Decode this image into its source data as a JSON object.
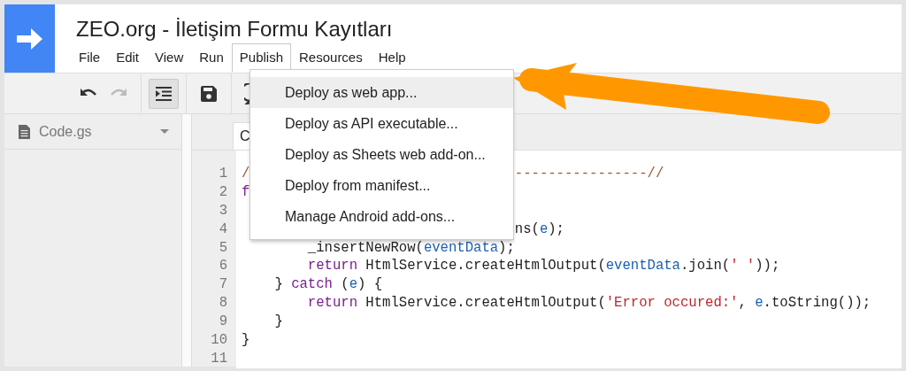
{
  "app": {
    "title": "ZEO.org - İletişim Formu Kayıtları"
  },
  "menu_bar": [
    {
      "label": "File",
      "selected": false
    },
    {
      "label": "Edit",
      "selected": false
    },
    {
      "label": "View",
      "selected": false
    },
    {
      "label": "Run",
      "selected": false
    },
    {
      "label": "Publish",
      "selected": true
    },
    {
      "label": "Resources",
      "selected": false
    },
    {
      "label": "Help",
      "selected": false
    }
  ],
  "toolbar": [
    {
      "kind": "undo",
      "disabled": false,
      "pressed": false
    },
    {
      "kind": "redo",
      "disabled": true,
      "pressed": false
    },
    {
      "kind": "indent",
      "disabled": false,
      "pressed": true
    },
    {
      "kind": "save",
      "disabled": false,
      "pressed": false
    },
    {
      "kind": "trigger",
      "disabled": false,
      "pressed": false
    }
  ],
  "sidebar": {
    "files": [
      {
        "name": "Code.gs"
      }
    ]
  },
  "editor": {
    "tab": "C",
    "lines": [
      {
        "number": "1",
        "tokens": [
          {
            "text": "/",
            "kind": "comment"
          },
          {
            "text": "                                ----------------//",
            "kind": "comment"
          }
        ]
      },
      {
        "number": "2",
        "tokens": [
          {
            "text": "f",
            "kind": "keyword"
          }
        ]
      },
      {
        "number": "3"
      },
      {
        "number": "4",
        "tokens": [
          {
            "text": "                                 ns(",
            "kind": "plain"
          },
          {
            "text": "e",
            "kind": "var"
          },
          {
            "text": ");",
            "kind": "plain"
          }
        ]
      },
      {
        "number": "5",
        "tokens": [
          {
            "text": "        _insertNewRow(",
            "kind": "plain"
          },
          {
            "text": "eventData",
            "kind": "var"
          },
          {
            "text": ");",
            "kind": "plain"
          }
        ]
      },
      {
        "number": "6",
        "tokens": [
          {
            "text": "        return",
            "kind": "keyword"
          },
          {
            "text": " HtmlService.createHtmlOutput(",
            "kind": "plain"
          },
          {
            "text": "eventData",
            "kind": "var"
          },
          {
            "text": ".join(",
            "kind": "plain"
          },
          {
            "text": "' '",
            "kind": "string"
          },
          {
            "text": "));",
            "kind": "plain"
          }
        ]
      },
      {
        "number": "7",
        "tokens": [
          {
            "text": "    } ",
            "kind": "plain"
          },
          {
            "text": "catch",
            "kind": "keyword"
          },
          {
            "text": " (",
            "kind": "plain"
          },
          {
            "text": "e",
            "kind": "var"
          },
          {
            "text": ") {",
            "kind": "plain"
          }
        ]
      },
      {
        "number": "8",
        "tokens": [
          {
            "text": "        return",
            "kind": "keyword"
          },
          {
            "text": " HtmlService.createHtmlOutput(",
            "kind": "plain"
          },
          {
            "text": "'Error occured:'",
            "kind": "string"
          },
          {
            "text": ", ",
            "kind": "plain"
          },
          {
            "text": "e",
            "kind": "var"
          },
          {
            "text": ".toString());",
            "kind": "plain"
          }
        ]
      },
      {
        "number": "9",
        "tokens": [
          {
            "text": "    }",
            "kind": "plain"
          }
        ]
      },
      {
        "number": "10",
        "tokens": [
          {
            "text": "}",
            "kind": "plain"
          }
        ]
      },
      {
        "number": "11"
      }
    ]
  },
  "publish_menu": [
    {
      "label": "Deploy as web app...",
      "selected": true
    },
    {
      "label": "Deploy as API executable...",
      "selected": false
    },
    {
      "label": "Deploy as Sheets web add-on...",
      "selected": false
    },
    {
      "label": "Deploy from manifest...",
      "selected": false
    },
    {
      "label": "Manage Android add-ons...",
      "selected": false
    }
  ]
}
